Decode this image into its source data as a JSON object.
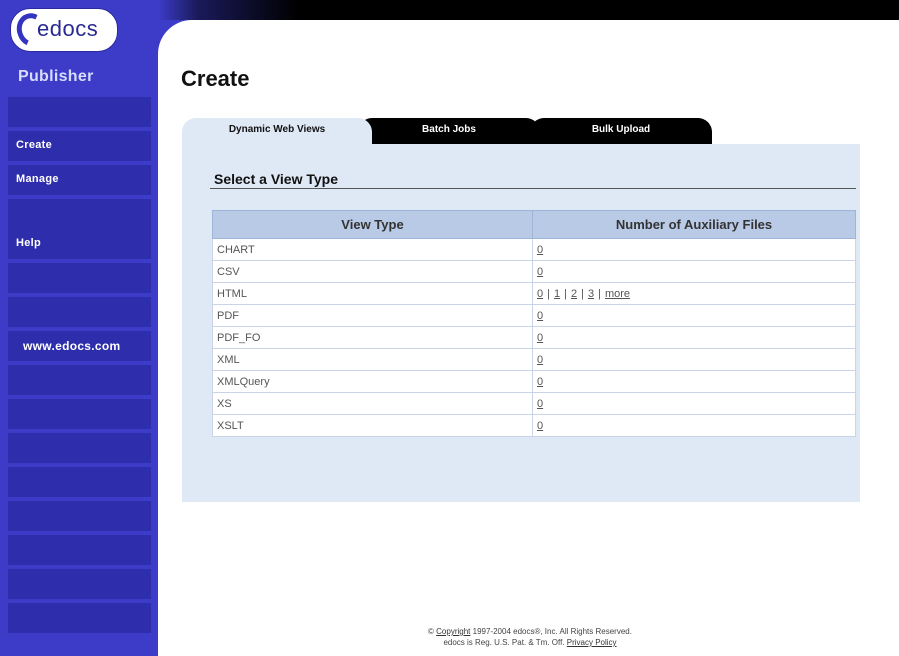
{
  "logo": {
    "text": "edocs"
  },
  "sidebar": {
    "product_name": "Publisher",
    "items": [
      {
        "label": ""
      },
      {
        "label": "Create"
      },
      {
        "label": "Manage"
      },
      {
        "label": ""
      },
      {
        "label": "Help"
      },
      {
        "label": ""
      },
      {
        "label": ""
      },
      {
        "label": "www.edocs.com"
      }
    ]
  },
  "page": {
    "title": "Create"
  },
  "tabs": [
    {
      "label": "Dynamic Web Views",
      "active": true
    },
    {
      "label": "Batch Jobs",
      "active": false
    },
    {
      "label": "Bulk Upload",
      "active": false
    }
  ],
  "section": {
    "title": "Select a View Type"
  },
  "table": {
    "headers": [
      "View Type",
      "Number of Auxiliary Files"
    ],
    "rows": [
      {
        "type": "CHART",
        "aux": [
          "0"
        ]
      },
      {
        "type": "CSV",
        "aux": [
          "0"
        ]
      },
      {
        "type": "HTML",
        "aux": [
          "0",
          "1",
          "2",
          "3",
          "more"
        ]
      },
      {
        "type": "PDF",
        "aux": [
          "0"
        ]
      },
      {
        "type": "PDF_FO",
        "aux": [
          "0"
        ]
      },
      {
        "type": "XML",
        "aux": [
          "0"
        ]
      },
      {
        "type": "XMLQuery",
        "aux": [
          "0"
        ]
      },
      {
        "type": "XS",
        "aux": [
          "0"
        ]
      },
      {
        "type": "XSLT",
        "aux": [
          "0"
        ]
      }
    ]
  },
  "footer": {
    "copyright_link": "Copyright",
    "line1_rest": "1997-2004 edocs®, Inc. All Rights Reserved.",
    "line2_text": "edocs is Reg. U.S. Pat. & Tm. Off.",
    "privacy_link": "Privacy Policy"
  },
  "colors": {
    "sidebar_bg": "#3c3cc8",
    "sidebar_row": "#2e2eac",
    "panel_bg": "#dfe8f5",
    "table_header_bg": "#b8cae6",
    "tab_inactive_bg": "#000000"
  }
}
